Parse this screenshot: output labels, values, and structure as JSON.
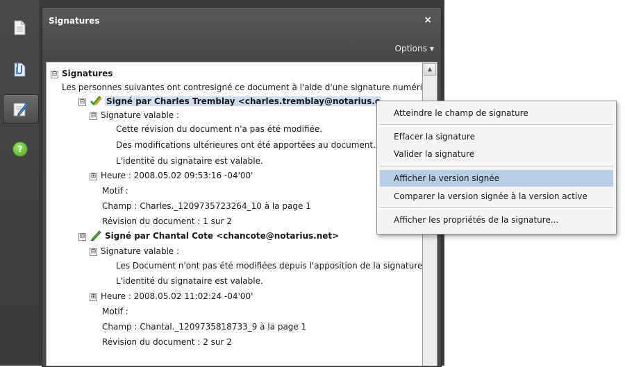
{
  "panel": {
    "title": "Signatures",
    "close_glyph": "×",
    "options_label": "Options",
    "options_caret": "▼"
  },
  "rail": {
    "icons": [
      "pages-icon",
      "attachments-icon",
      "signatures-icon",
      "help-icon"
    ],
    "help_glyph": "?"
  },
  "tree": {
    "root_toggle": "⊟",
    "root_label": "Signatures",
    "intro": "Les personnes suivantes ont contresigné ce document à l'aide d'une signature numérique.",
    "signatures": [
      {
        "toggle": "⊟",
        "title": "Signé par Charles Tremblay <charles.tremblay@notarius.c",
        "valid_toggle": "⊟",
        "valid_label": "Signature valable :",
        "details": [
          "Cette révision du document n'a pas été modifiée.",
          "Des modifications ultérieures ont été apportées au document.",
          "L'identité du signataire est valable."
        ],
        "time_toggle": "⊞",
        "time": "Heure : 2008.05.02 09:53:16 -04'00'",
        "reason": "Motif :",
        "field": "Champ : Charles._1209735723264_10 à la page 1",
        "revision": "Révision du document : 1 sur 2"
      },
      {
        "toggle": "⊟",
        "title": "Signé par Chantal Cote <chancote@notarius.net>",
        "valid_toggle": "⊟",
        "valid_label": "Signature valable :",
        "details": [
          "Les Document n'ont pas été modifiées depuis l'apposition de la signature.",
          "L'identité du signataire est valable."
        ],
        "time_toggle": "⊞",
        "time": "Heure : 2008.05.02 11:02:24 -04'00'",
        "reason": "Motif :",
        "field": "Champ : Chantal._1209735818733_9 à la page 1",
        "revision": "Révision du document : 2 sur 2"
      }
    ]
  },
  "context_menu": {
    "items": [
      {
        "label": "Atteindre le champ de signature"
      },
      {
        "label": "Effacer la signature"
      },
      {
        "label": "Valider la signature"
      },
      {
        "label": "Afficher la version signée",
        "highlighted": true
      },
      {
        "label": "Comparer la version signée à la version active"
      },
      {
        "label": "Afficher les propriétés de la signature..."
      }
    ]
  },
  "colors": {
    "rail_bg": "#3c3c3c",
    "highlight": "#b6cde6",
    "help_green": "#5cb531"
  }
}
